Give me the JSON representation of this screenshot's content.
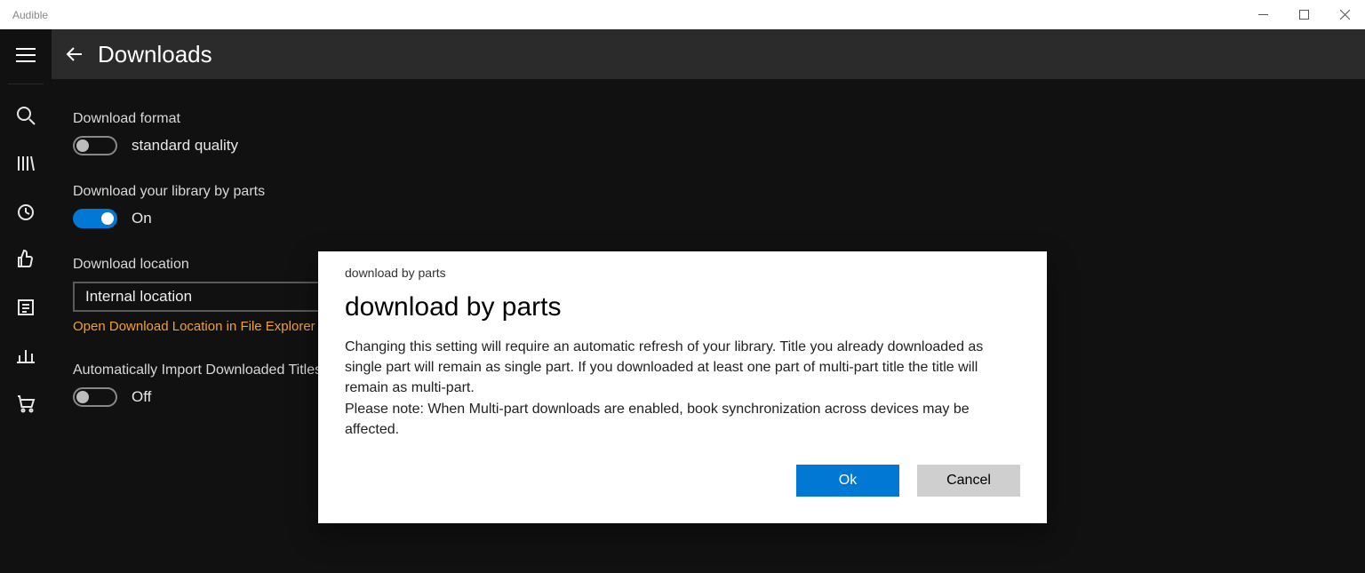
{
  "window": {
    "title": "Audible"
  },
  "header": {
    "title": "Downloads"
  },
  "settings": {
    "download_format": {
      "label": "Download format",
      "value": "standard quality",
      "on": false
    },
    "download_by_parts": {
      "label": "Download your library by parts",
      "value": "On",
      "on": true
    },
    "download_location": {
      "label": "Download location",
      "value": "Internal location",
      "link": "Open Download Location in File Explorer"
    },
    "auto_import": {
      "label": "Automatically Import Downloaded Titles",
      "value": "Off",
      "on": false
    }
  },
  "dialog": {
    "tag": "download by parts",
    "title": "download by parts",
    "body1": "Changing this setting will require an automatic refresh of your library. Title you already downloaded as single part will remain as single part. If you downloaded at least one part of multi-part title the title will remain as multi-part.",
    "body2": "Please note: When Multi-part downloads are enabled, book synchronization across devices may be affected.",
    "ok": "Ok",
    "cancel": "Cancel"
  }
}
